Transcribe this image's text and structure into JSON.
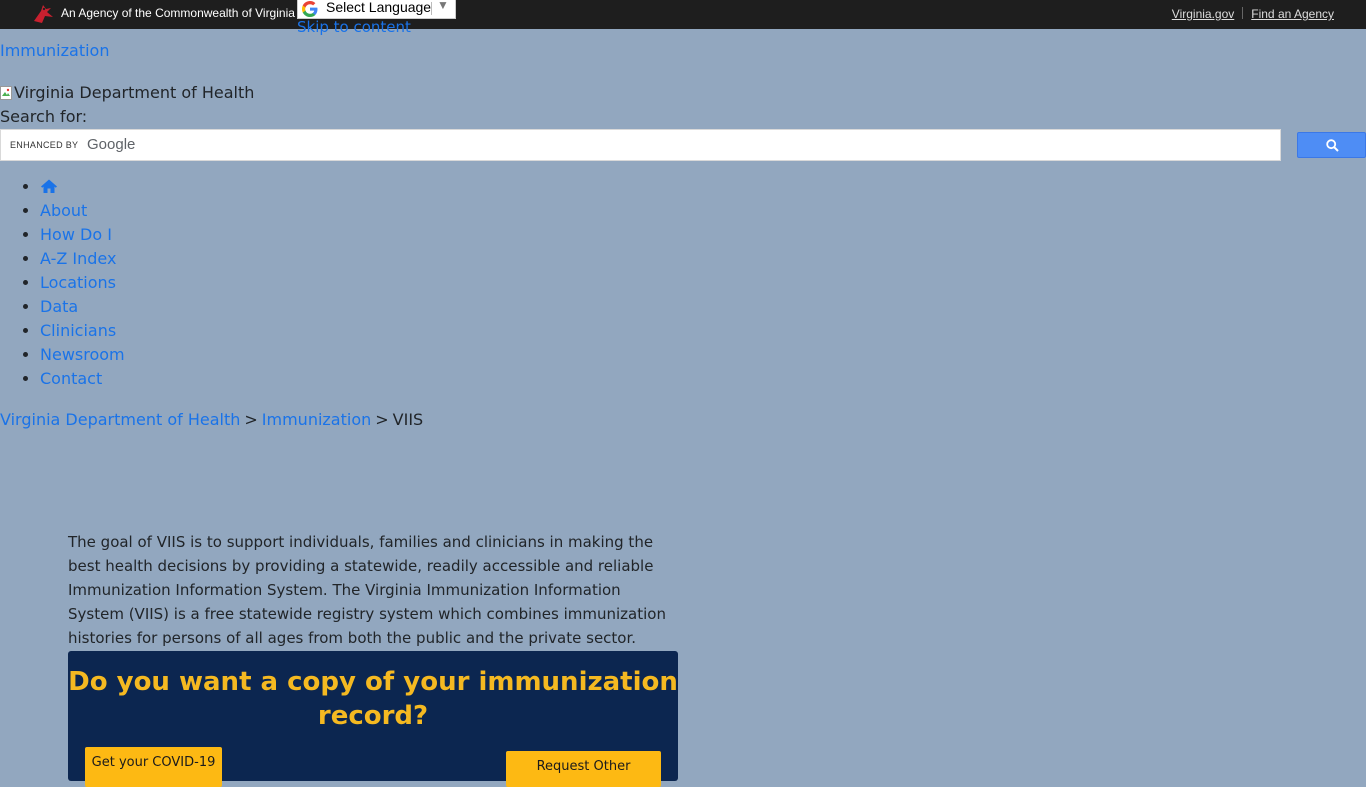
{
  "topbar": {
    "agency_text": "An Agency of the Commonwealth of Virginia",
    "language_select": "Select Language",
    "skip_link": "Skip to content",
    "links": [
      "Virginia.gov",
      "Find an Agency"
    ]
  },
  "header": {
    "site_name": "Immunization",
    "logo_alt": "Virginia Department of Health",
    "search_label": "Search for:",
    "search_enhanced": "ENHANCED BY",
    "search_brand": "Google"
  },
  "nav": {
    "items": [
      "About",
      "How Do I",
      "A-Z Index",
      "Locations",
      "Data",
      "Clinicians",
      "Newsroom",
      "Contact"
    ]
  },
  "breadcrumb": {
    "items": [
      "Virginia Department of Health",
      "Immunization"
    ],
    "current": "VIIS",
    "separator": ">"
  },
  "main": {
    "intro": "The goal of VIIS is to support individuals, families and clinicians in making the best health decisions by providing a statewide, readily accessible and reliable Immunization Information System. The Virginia Immunization Information System (VIIS) is a free statewide registry system which combines immunization histories for persons of all ages from both the public and the private sector.",
    "record_title": "Do you want a copy of your immunization record?",
    "btn_covid": "Get your COVID-19",
    "btn_other": "Request Other"
  },
  "colors": {
    "page_bg": "#92a7bf",
    "topbar_bg": "#1e1e1e",
    "link": "#1a73e8",
    "record_bg": "#0c2650",
    "record_title": "#f5b921",
    "button_bg": "#fdb913"
  }
}
